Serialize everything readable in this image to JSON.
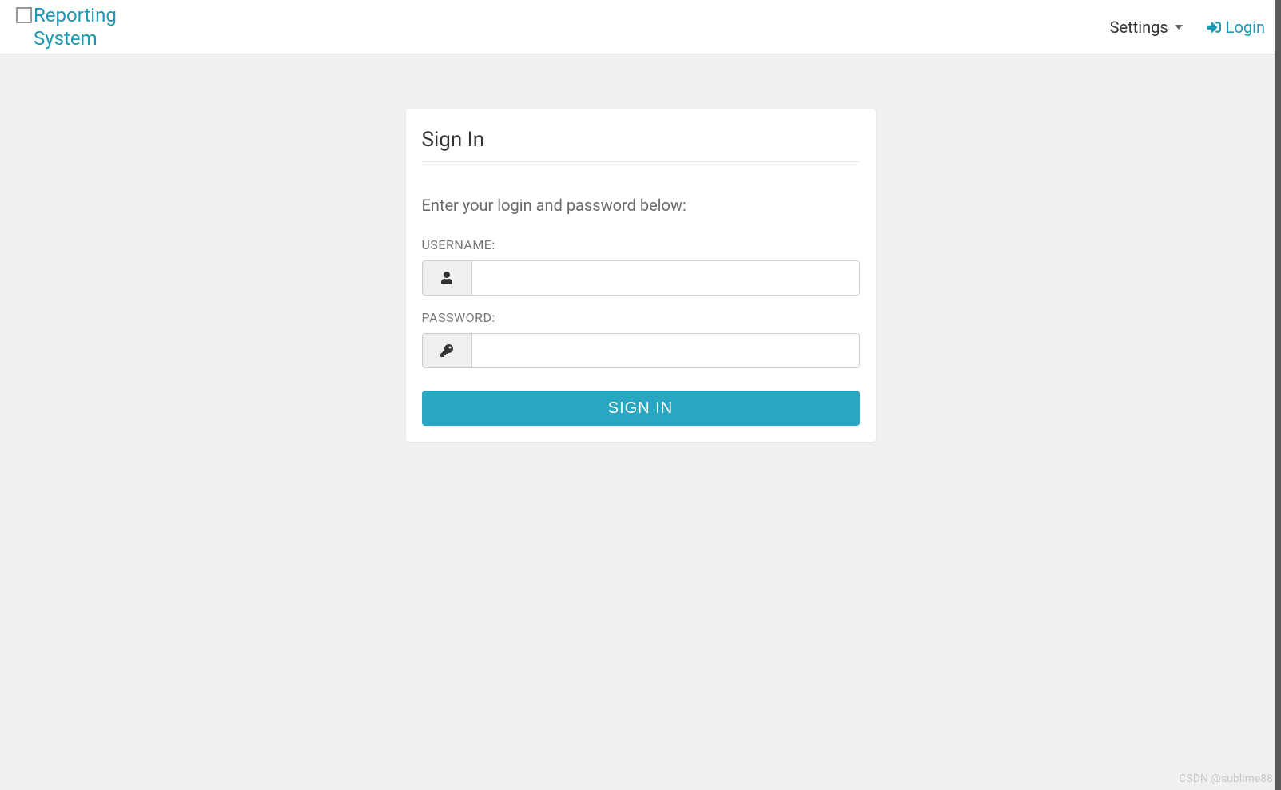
{
  "navbar": {
    "brand_text": "Reporting System",
    "settings_label": "Settings",
    "login_label": "Login"
  },
  "login_card": {
    "title": "Sign In",
    "instruction": "Enter your login and password below:",
    "username_label": "USERNAME:",
    "password_label": "PASSWORD:",
    "username_value": "",
    "password_value": "",
    "signin_button_label": "SIGN IN"
  },
  "watermark": "CSDN @sublime88"
}
